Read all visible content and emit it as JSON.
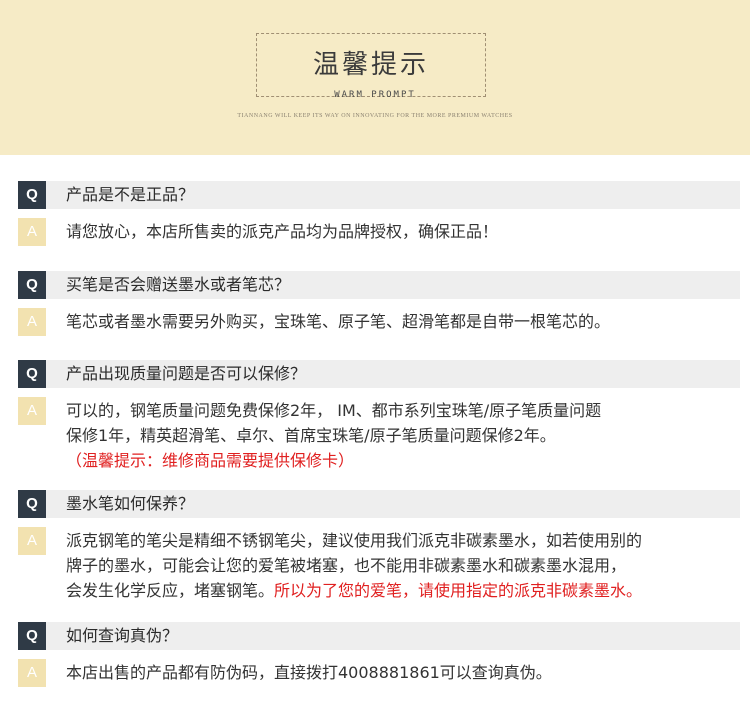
{
  "header": {
    "title": "温馨提示",
    "subtitle": "WARM PROMPT",
    "tagline": "TIANNANG WILL KEEP ITS WAY ON INNOVATING FOR THE MORE PREMIUM WATCHES"
  },
  "badges": {
    "q": "Q",
    "a": "A"
  },
  "qa": [
    {
      "question": "产品是不是正品？",
      "answer": [
        "请您放心，本店所售卖的派克产品均为品牌授权，确保正品！"
      ]
    },
    {
      "question": "买笔是否会赠送墨水或者笔芯？",
      "answer": [
        "笔芯或者墨水需要另外购买，宝珠笔、原子笔、超滑笔都是自带一根笔芯的。"
      ]
    },
    {
      "question": "产品出现质量问题是否可以保修？",
      "answer": [
        "可以的，钢笔质量问题免费保修2年， IM、都市系列宝珠笔/原子笔质量问题",
        "保修1年，精英超滑笔、卓尔、首席宝珠笔/原子笔质量问题保修2年。"
      ],
      "note": "（温馨提示：维修商品需要提供保修卡）"
    },
    {
      "question": "墨水笔如何保养？",
      "answer": [
        "派克钢笔的笔尖是精细不锈钢笔尖，建议使用我们派克非碳素墨水，如若使用别的",
        "牌子的墨水，可能会让您的爱笔被堵塞，也不能用非碳素墨水和碳素墨水混用，",
        "会发生化学反应，堵塞钢笔。"
      ],
      "note": "所以为了您的爱笔，请使用指定的派克非碳素墨水。"
    },
    {
      "question": "如何查询真伪？",
      "answer": [
        "本店出售的产品都有防伪码，直接拨打4008881861可以查询真伪。"
      ]
    }
  ]
}
